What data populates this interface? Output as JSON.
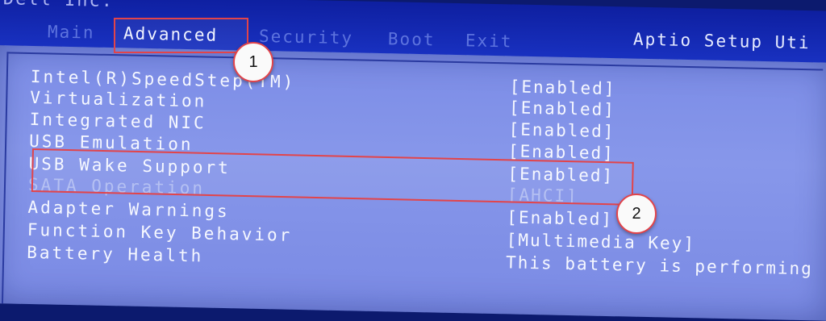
{
  "header": {
    "vendor": "Dell Inc.",
    "brand": "Aptio Setup Uti",
    "tabs": [
      {
        "label": "Main",
        "active": false
      },
      {
        "label": "Advanced",
        "active": true
      },
      {
        "label": "Security",
        "active": false
      },
      {
        "label": "Boot",
        "active": false
      },
      {
        "label": "Exit",
        "active": false
      }
    ]
  },
  "settings": [
    {
      "label": "Intel(R)SpeedStep(TM)",
      "value": "[Enabled]",
      "disabled": false
    },
    {
      "label": "Virtualization",
      "value": "[Enabled]",
      "disabled": false
    },
    {
      "label": "Integrated NIC",
      "value": "[Enabled]",
      "disabled": false
    },
    {
      "label": "USB Emulation",
      "value": "[Enabled]",
      "disabled": false
    },
    {
      "label": "USB Wake Support",
      "value": "[Enabled]",
      "disabled": false
    },
    {
      "label": "SATA Operation",
      "value": "[AHCI]",
      "disabled": true
    },
    {
      "label": "Adapter Warnings",
      "value": "[Enabled]",
      "disabled": false
    },
    {
      "label": "Function Key Behavior",
      "value": "[Multimedia Key]",
      "disabled": false
    },
    {
      "label": "Battery Health",
      "value": "This battery is performing",
      "disabled": false
    }
  ],
  "annotations": {
    "step1": "1",
    "step2": "2",
    "color": "#e2444a"
  }
}
